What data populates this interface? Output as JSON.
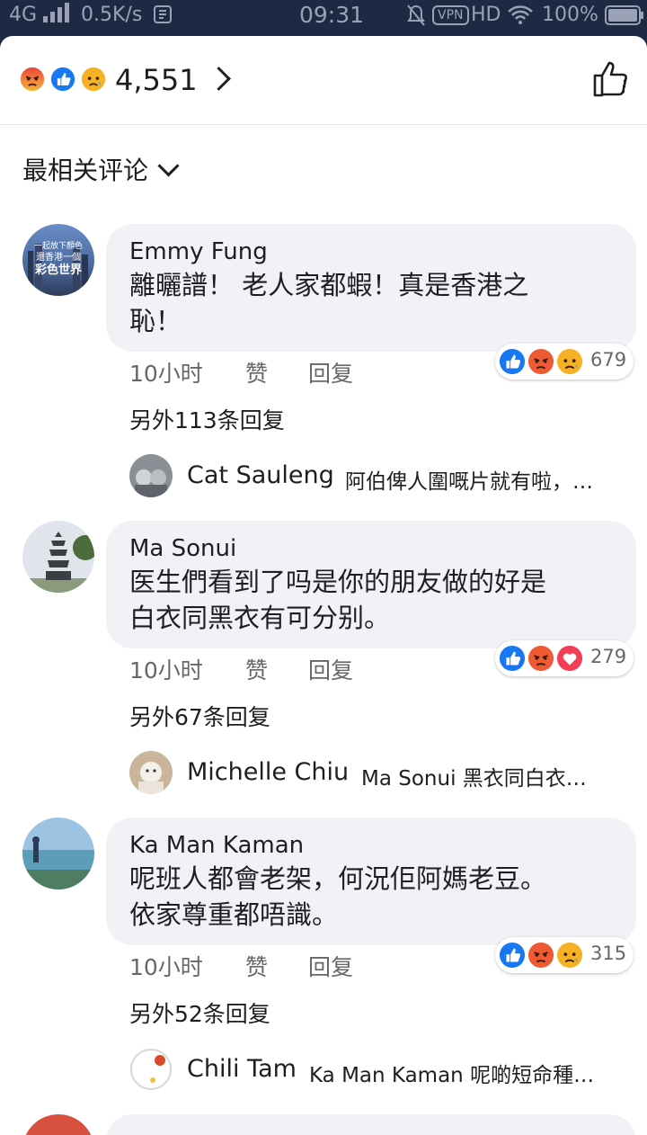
{
  "status_bar": {
    "network": "4G",
    "speed": "0.5K/s",
    "time": "09:31",
    "vpn": "VPN",
    "hd": "HD",
    "battery": "100%"
  },
  "reactions_header": {
    "icons": [
      "angry-icon",
      "like-icon",
      "sad-icon"
    ],
    "count": "4,551"
  },
  "sort": {
    "label": "最相关评论"
  },
  "comments": [
    {
      "author": "Emmy Fung",
      "avatar_text": [
        "一起放下顏色",
        "還香港一個",
        "彩色世界"
      ],
      "text_lines": [
        "離曬譜！ 老人家都蝦！真是香港之",
        "恥！"
      ],
      "time": "10小时",
      "like": "赞",
      "reply": "回复",
      "reactions": [
        "like-icon",
        "angry-icon",
        "sad-icon"
      ],
      "reaction_count": "679",
      "more_replies": "另外113条回复",
      "first_reply": {
        "author": "Cat Sauleng",
        "text": "阿伯俾人圍嘅片就有啦，…"
      }
    },
    {
      "author": "Ma Sonui",
      "text_lines": [
        "医生們看到了吗是你的朋友做的好是",
        "白衣同黑衣有可分别。"
      ],
      "time": "10小时",
      "like": "赞",
      "reply": "回复",
      "reactions": [
        "like-icon",
        "angry-icon",
        "love-icon"
      ],
      "reaction_count": "279",
      "more_replies": "另外67条回复",
      "first_reply": {
        "author": "Michelle Chiu",
        "text": "Ma Sonui 黑衣同白衣…"
      }
    },
    {
      "author": "Ka Man Kaman",
      "text_lines": [
        "呢班人都會老架，何況佢阿媽老豆。",
        "依家尊重都唔識。"
      ],
      "time": "10小时",
      "like": "赞",
      "reply": "回复",
      "reactions": [
        "like-icon",
        "angry-icon",
        "sad-icon"
      ],
      "reaction_count": "315",
      "more_replies": "另外52条回复",
      "first_reply": {
        "author": "Chili Tam",
        "text": "Ka Man Kaman 呢啲短命種…"
      }
    }
  ],
  "colors": {
    "like": "#1877f2",
    "angry": "#f0883a",
    "sad": "#f7b125",
    "love": "#f33e58",
    "bubble": "#f0f2f5",
    "meta": "#65676b"
  }
}
